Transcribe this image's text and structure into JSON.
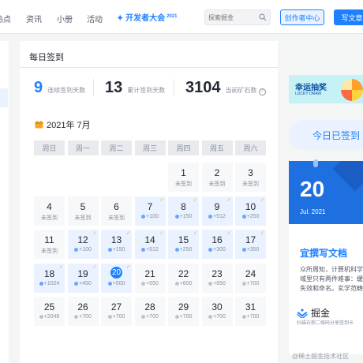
{
  "nav": {
    "items": [
      "热点",
      "资讯",
      "小册",
      "活动"
    ],
    "event_name": "开发者大会",
    "event_year": "2021",
    "search_placeholder": "探索掘金",
    "creator_center": "创作者中心",
    "write_article": "写文章"
  },
  "checkin": {
    "title": "每日签到",
    "stats": [
      {
        "value": "9",
        "label": "连续签到天数"
      },
      {
        "value": "13",
        "label": "累计签到天数"
      },
      {
        "value": "3104",
        "label": "当前矿石数"
      }
    ],
    "month": "2021年 7月",
    "weekdays": [
      "周日",
      "周一",
      "周二",
      "周三",
      "周四",
      "周五",
      "周六"
    ],
    "days": [
      {
        "day": "1",
        "sub": "未签到",
        "status": "unsigned"
      },
      {
        "day": "2",
        "sub": "未签到",
        "status": "unsigned"
      },
      {
        "day": "3",
        "sub": "未签到",
        "status": "unsigned"
      },
      {
        "day": "4",
        "sub": "未签到",
        "status": "unsigned"
      },
      {
        "day": "5",
        "sub": "未签到",
        "status": "unsigned"
      },
      {
        "day": "6",
        "sub": "未签到",
        "status": "unsigned"
      },
      {
        "day": "7",
        "sub": "+100",
        "status": "signed"
      },
      {
        "day": "8",
        "sub": "+150",
        "status": "signed"
      },
      {
        "day": "9",
        "sub": "+512",
        "status": "signed"
      },
      {
        "day": "10",
        "sub": "+250",
        "status": "signed"
      },
      {
        "day": "11",
        "sub": "未签到",
        "status": "unsigned"
      },
      {
        "day": "12",
        "sub": "+100",
        "status": "signed"
      },
      {
        "day": "13",
        "sub": "+150",
        "status": "signed"
      },
      {
        "day": "14",
        "sub": "+512",
        "status": "signed"
      },
      {
        "day": "15",
        "sub": "+250",
        "status": "signed"
      },
      {
        "day": "16",
        "sub": "+300",
        "status": "signed"
      },
      {
        "day": "17",
        "sub": "+350",
        "status": "signed"
      },
      {
        "day": "18",
        "sub": "+1024",
        "status": "signed"
      },
      {
        "day": "19",
        "sub": "+450",
        "status": "signed"
      },
      {
        "day": "20",
        "sub": "+500",
        "status": "today"
      },
      {
        "day": "21",
        "sub": "+550",
        "status": "future"
      },
      {
        "day": "22",
        "sub": "+600",
        "status": "future"
      },
      {
        "day": "23",
        "sub": "+650",
        "status": "future"
      },
      {
        "day": "24",
        "sub": "+700",
        "status": "future"
      },
      {
        "day": "25",
        "sub": "+2048",
        "status": "future"
      },
      {
        "day": "26",
        "sub": "+700",
        "status": "future"
      },
      {
        "day": "27",
        "sub": "+700",
        "status": "future"
      },
      {
        "day": "28",
        "sub": "+700",
        "status": "future"
      },
      {
        "day": "29",
        "sub": "+700",
        "status": "future"
      },
      {
        "day": "30",
        "sub": "+700",
        "status": "future"
      },
      {
        "day": "31",
        "sub": "+700",
        "status": "future"
      }
    ]
  },
  "right": {
    "lucky_title": "幸运抽奖",
    "lucky_sub": "LUCKY DRAW",
    "signed_label": "今日已签到",
    "date_day": "20",
    "date_month": "Jul. 2021",
    "quote_title": "宜撰写文档",
    "quote_body": "众所周知，计算机科学领域里只有两件难事：缓存失效和命名。玄学范畴",
    "brand": "掘金",
    "brand_sub": "扫描右侧二维码分享签到卡"
  },
  "watermark": "@稀土掘金技术社区",
  "colors": {
    "accent": "#1e80ff",
    "signed_bg": "#eaf2ff",
    "unsigned_bg": "#f7f8fa"
  }
}
